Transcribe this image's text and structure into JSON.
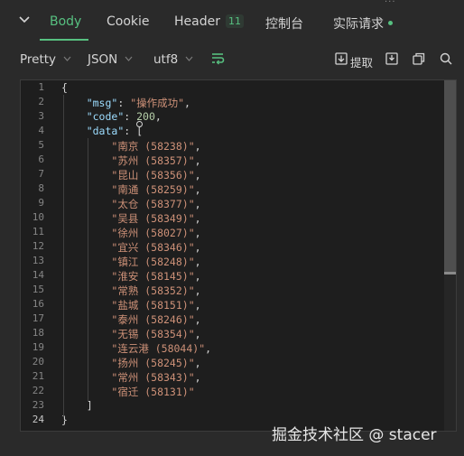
{
  "tabs": {
    "body": "Body",
    "cookie": "Cookie",
    "header": "Header",
    "header_count": "11",
    "console": "控制台",
    "actual_request": "实际请求"
  },
  "toolbar": {
    "format": "Pretty",
    "type": "JSON",
    "encoding": "utf8",
    "extract_label": "提取"
  },
  "colors": {
    "accent": "#57c080",
    "background": "#2a2a2a",
    "editor": "#1e1e1e"
  },
  "icons": [
    "collapse-chevron-icon",
    "wrap-lines-icon",
    "extract-icon",
    "download-icon",
    "copy-icon",
    "search-icon"
  ],
  "editor": {
    "current_line": 24,
    "lines": [
      {
        "n": "1",
        "parts": [
          {
            "t": "{",
            "c": "punc"
          }
        ]
      },
      {
        "n": "2",
        "parts": [
          {
            "t": "    ",
            "c": "punc"
          },
          {
            "t": "\"msg\"",
            "c": "key"
          },
          {
            "t": ": ",
            "c": "punc"
          },
          {
            "t": "\"操作成功\"",
            "c": "str"
          },
          {
            "t": ",",
            "c": "punc"
          }
        ]
      },
      {
        "n": "3",
        "parts": [
          {
            "t": "    ",
            "c": "punc"
          },
          {
            "t": "\"code\"",
            "c": "key"
          },
          {
            "t": ": ",
            "c": "punc"
          },
          {
            "t": "200",
            "c": "num"
          },
          {
            "t": ",",
            "c": "punc"
          }
        ]
      },
      {
        "n": "4",
        "parts": [
          {
            "t": "    ",
            "c": "punc"
          },
          {
            "t": "\"data\"",
            "c": "key"
          },
          {
            "t": ": [",
            "c": "punc"
          }
        ]
      },
      {
        "n": "5",
        "parts": [
          {
            "t": "        ",
            "c": "punc"
          },
          {
            "t": "\"南京 (58238)\"",
            "c": "str"
          },
          {
            "t": ",",
            "c": "punc"
          }
        ]
      },
      {
        "n": "6",
        "parts": [
          {
            "t": "        ",
            "c": "punc"
          },
          {
            "t": "\"苏州 (58357)\"",
            "c": "str"
          },
          {
            "t": ",",
            "c": "punc"
          }
        ]
      },
      {
        "n": "7",
        "parts": [
          {
            "t": "        ",
            "c": "punc"
          },
          {
            "t": "\"昆山 (58356)\"",
            "c": "str"
          },
          {
            "t": ",",
            "c": "punc"
          }
        ]
      },
      {
        "n": "8",
        "parts": [
          {
            "t": "        ",
            "c": "punc"
          },
          {
            "t": "\"南通 (58259)\"",
            "c": "str"
          },
          {
            "t": ",",
            "c": "punc"
          }
        ]
      },
      {
        "n": "9",
        "parts": [
          {
            "t": "        ",
            "c": "punc"
          },
          {
            "t": "\"太仓 (58377)\"",
            "c": "str"
          },
          {
            "t": ",",
            "c": "punc"
          }
        ]
      },
      {
        "n": "10",
        "parts": [
          {
            "t": "        ",
            "c": "punc"
          },
          {
            "t": "\"吴县 (58349)\"",
            "c": "str"
          },
          {
            "t": ",",
            "c": "punc"
          }
        ]
      },
      {
        "n": "11",
        "parts": [
          {
            "t": "        ",
            "c": "punc"
          },
          {
            "t": "\"徐州 (58027)\"",
            "c": "str"
          },
          {
            "t": ",",
            "c": "punc"
          }
        ]
      },
      {
        "n": "12",
        "parts": [
          {
            "t": "        ",
            "c": "punc"
          },
          {
            "t": "\"宜兴 (58346)\"",
            "c": "str"
          },
          {
            "t": ",",
            "c": "punc"
          }
        ]
      },
      {
        "n": "13",
        "parts": [
          {
            "t": "        ",
            "c": "punc"
          },
          {
            "t": "\"镇江 (58248)\"",
            "c": "str"
          },
          {
            "t": ",",
            "c": "punc"
          }
        ]
      },
      {
        "n": "14",
        "parts": [
          {
            "t": "        ",
            "c": "punc"
          },
          {
            "t": "\"淮安 (58145)\"",
            "c": "str"
          },
          {
            "t": ",",
            "c": "punc"
          }
        ]
      },
      {
        "n": "15",
        "parts": [
          {
            "t": "        ",
            "c": "punc"
          },
          {
            "t": "\"常熟 (58352)\"",
            "c": "str"
          },
          {
            "t": ",",
            "c": "punc"
          }
        ]
      },
      {
        "n": "16",
        "parts": [
          {
            "t": "        ",
            "c": "punc"
          },
          {
            "t": "\"盐城 (58151)\"",
            "c": "str"
          },
          {
            "t": ",",
            "c": "punc"
          }
        ]
      },
      {
        "n": "17",
        "parts": [
          {
            "t": "        ",
            "c": "punc"
          },
          {
            "t": "\"泰州 (58246)\"",
            "c": "str"
          },
          {
            "t": ",",
            "c": "punc"
          }
        ]
      },
      {
        "n": "18",
        "parts": [
          {
            "t": "        ",
            "c": "punc"
          },
          {
            "t": "\"无锡 (58354)\"",
            "c": "str"
          },
          {
            "t": ",",
            "c": "punc"
          }
        ]
      },
      {
        "n": "19",
        "parts": [
          {
            "t": "        ",
            "c": "punc"
          },
          {
            "t": "\"连云港 (58044)\"",
            "c": "str"
          },
          {
            "t": ",",
            "c": "punc"
          }
        ]
      },
      {
        "n": "20",
        "parts": [
          {
            "t": "        ",
            "c": "punc"
          },
          {
            "t": "\"扬州 (58245)\"",
            "c": "str"
          },
          {
            "t": ",",
            "c": "punc"
          }
        ]
      },
      {
        "n": "21",
        "parts": [
          {
            "t": "        ",
            "c": "punc"
          },
          {
            "t": "\"常州 (58343)\"",
            "c": "str"
          },
          {
            "t": ",",
            "c": "punc"
          }
        ]
      },
      {
        "n": "22",
        "parts": [
          {
            "t": "        ",
            "c": "punc"
          },
          {
            "t": "\"宿迁 (58131)\"",
            "c": "str"
          }
        ]
      },
      {
        "n": "23",
        "parts": [
          {
            "t": "    ",
            "c": "punc"
          },
          {
            "t": "]",
            "c": "punc"
          }
        ]
      },
      {
        "n": "24",
        "parts": [
          {
            "t": "}",
            "c": "punc"
          }
        ]
      }
    ]
  },
  "watermark": "掘金技术社区 @ stacer"
}
